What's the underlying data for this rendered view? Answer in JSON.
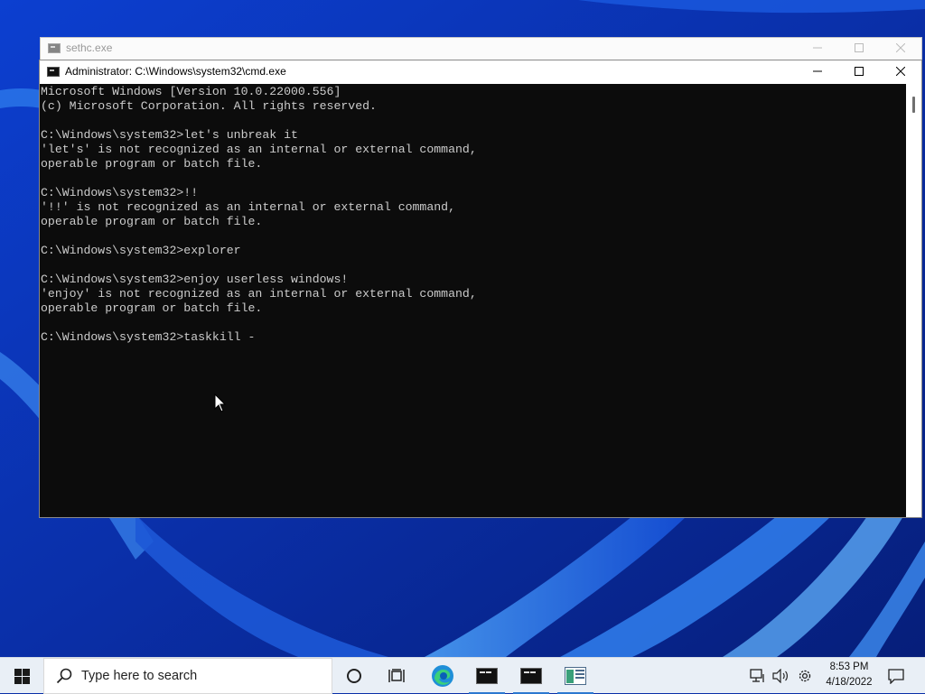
{
  "background_window": {
    "title": "sethc.exe"
  },
  "cmd_window": {
    "title": "Administrator: C:\\Windows\\system32\\cmd.exe",
    "console_lines": [
      "Microsoft Windows [Version 10.0.22000.556]",
      "(c) Microsoft Corporation. All rights reserved.",
      "",
      "C:\\Windows\\system32>let's unbreak it",
      "'let's' is not recognized as an internal or external command,",
      "operable program or batch file.",
      "",
      "C:\\Windows\\system32>!!",
      "'!!' is not recognized as an internal or external command,",
      "operable program or batch file.",
      "",
      "C:\\Windows\\system32>explorer",
      "",
      "C:\\Windows\\system32>enjoy userless windows!",
      "'enjoy' is not recognized as an internal or external command,",
      "operable program or batch file.",
      "",
      "C:\\Windows\\system32>taskkill -"
    ]
  },
  "taskbar": {
    "search_placeholder": "Type here to search",
    "time": "8:53 PM",
    "date": "4/18/2022",
    "icons": [
      "start-icon",
      "search-icon",
      "cortana-icon",
      "task-view-icon",
      "edge-icon",
      "cmd-icon",
      "cmd-icon",
      "app-icon",
      "network-icon",
      "volume-icon",
      "settings-icon",
      "notifications-icon"
    ]
  },
  "colors": {
    "console_bg": "#0c0c0c",
    "console_fg": "#cccccc",
    "wallpaper": "#0a2fa8",
    "accent": "#2b78d0"
  }
}
